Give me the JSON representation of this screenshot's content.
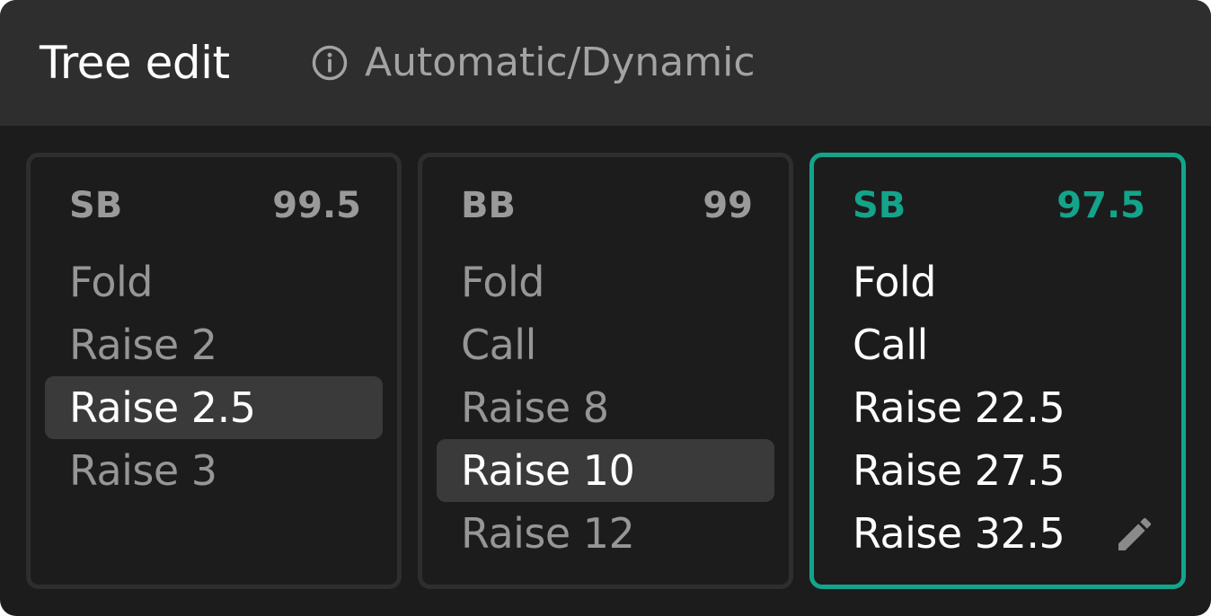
{
  "header": {
    "title": "Tree edit",
    "mode_label": "Automatic/Dynamic",
    "mode_icon": "info-circle-icon"
  },
  "cards": [
    {
      "position": "SB",
      "stack": "99.5",
      "actions": [
        "Fold",
        "Raise 2",
        "Raise 2.5",
        "Raise 3"
      ],
      "selected_action": "Raise 2.5",
      "active": false
    },
    {
      "position": "BB",
      "stack": "99",
      "actions": [
        "Fold",
        "Call",
        "Raise 8",
        "Raise 10",
        "Raise 12"
      ],
      "selected_action": "Raise 10",
      "active": false
    },
    {
      "position": "SB",
      "stack": "97.5",
      "actions": [
        "Fold",
        "Call",
        "Raise 22.5",
        "Raise 27.5",
        "Raise 32.5"
      ],
      "selected_action": null,
      "active": true,
      "edit_icon": "pencil-icon"
    }
  ],
  "colors": {
    "accent": "#13a48a",
    "background": "#1c1c1c",
    "header_background": "#2e2e2e",
    "selected_row": "#3a3a3a",
    "muted_text": "#969696"
  }
}
